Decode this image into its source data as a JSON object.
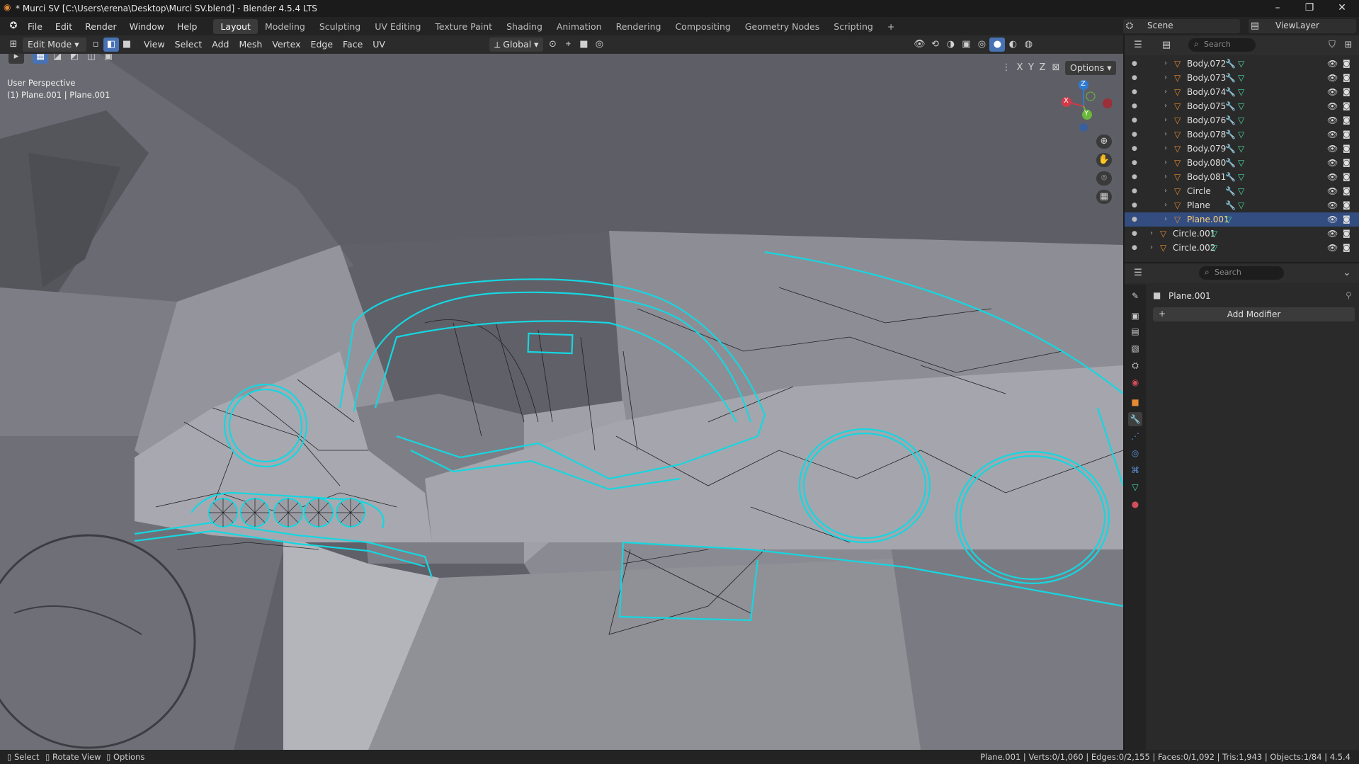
{
  "window": {
    "title": "* Murci SV [C:\\Users\\erena\\Desktop\\Murci SV.blend] - Blender 4.5.4 LTS",
    "minimize": "–",
    "maximize": "❐",
    "close": "✕"
  },
  "menus": [
    "File",
    "Edit",
    "Render",
    "Window",
    "Help"
  ],
  "workspaces": [
    "Layout",
    "Modeling",
    "Sculpting",
    "UV Editing",
    "Texture Paint",
    "Shading",
    "Animation",
    "Rendering",
    "Compositing",
    "Geometry Nodes",
    "Scripting"
  ],
  "active_workspace": "Layout",
  "scene": {
    "label": "Scene",
    "view_layer": "ViewLayer"
  },
  "viewport_header": {
    "mode": "Edit Mode",
    "menus": [
      "View",
      "Select",
      "Add",
      "Mesh",
      "Vertex",
      "Edge",
      "Face",
      "UV"
    ],
    "orientation": "Global",
    "options": "Options",
    "axes": [
      "X",
      "Y",
      "Z"
    ]
  },
  "viewport": {
    "perspective": "User Perspective",
    "object_info": "(1) Plane.001 | Plane.001",
    "gizmo": {
      "x": "X",
      "y": "Y",
      "z": "Z"
    },
    "wire_color": "#16d6e0"
  },
  "outliner": {
    "search_placeholder": "Search",
    "rows": [
      {
        "name": "Body.072",
        "indent": 1,
        "mod": true
      },
      {
        "name": "Body.073",
        "indent": 1,
        "mod": true
      },
      {
        "name": "Body.074",
        "indent": 1,
        "mod": true
      },
      {
        "name": "Body.075",
        "indent": 1,
        "mod": true
      },
      {
        "name": "Body.076",
        "indent": 1,
        "mod": true
      },
      {
        "name": "Body.078",
        "indent": 1,
        "mod": true
      },
      {
        "name": "Body.079",
        "indent": 1,
        "mod": true
      },
      {
        "name": "Body.080",
        "indent": 1,
        "mod": true
      },
      {
        "name": "Body.081",
        "indent": 1,
        "mod": true
      },
      {
        "name": "Circle",
        "indent": 1,
        "mod": true
      },
      {
        "name": "Plane",
        "indent": 1,
        "mod": true
      },
      {
        "name": "Plane.001",
        "indent": 1,
        "mod": false,
        "selected": true
      },
      {
        "name": "Circle.001",
        "indent": 0,
        "mod": false
      },
      {
        "name": "Circle.002",
        "indent": 0,
        "mod": false
      }
    ]
  },
  "properties": {
    "search_placeholder": "Search",
    "object_name": "Plane.001",
    "add_modifier": "Add Modifier"
  },
  "statusbar": {
    "left": [
      "Select",
      "Rotate View",
      "Options"
    ],
    "right": "Plane.001 | Verts:0/1,060 | Edges:0/2,155 | Faces:0/1,092 | Tris:1,943 | Objects:1/84 | 4.5.4"
  }
}
